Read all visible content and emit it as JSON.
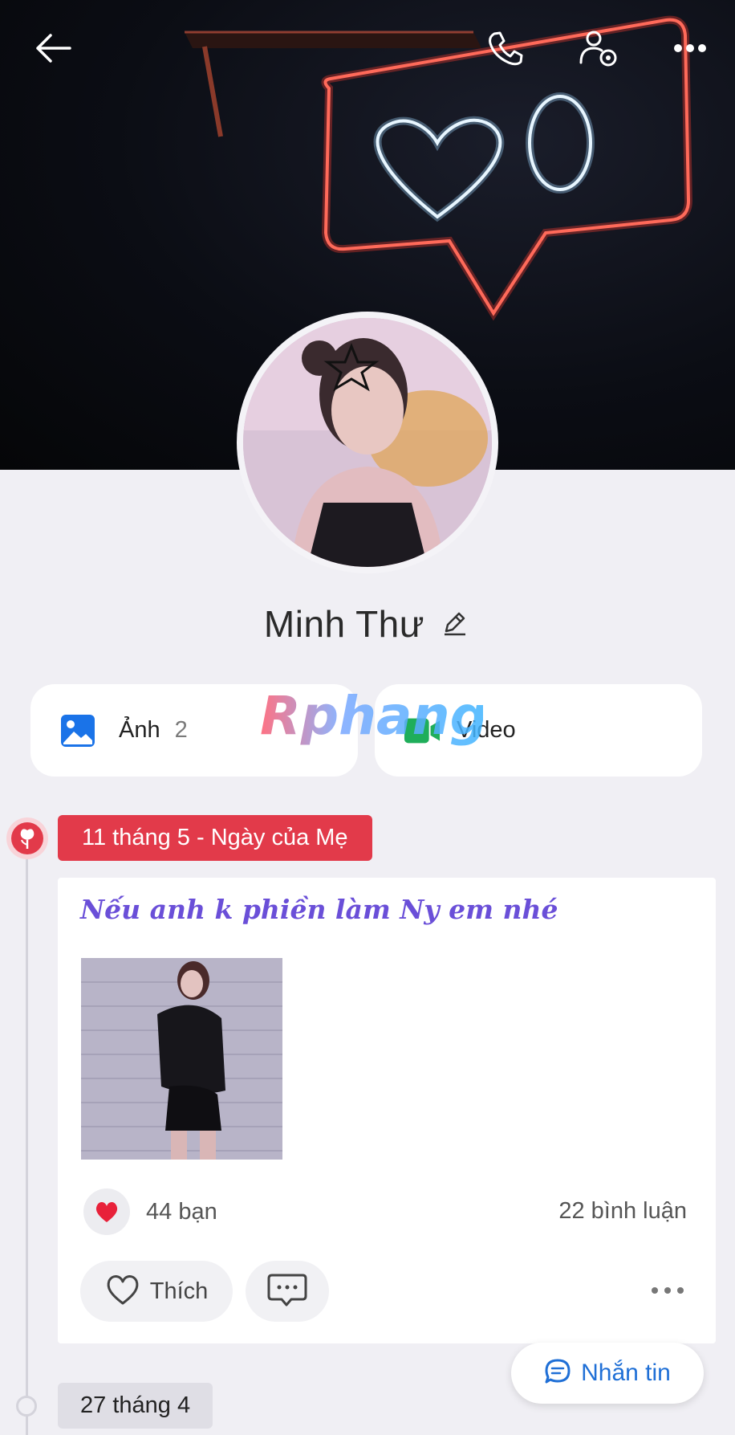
{
  "header": {
    "back_icon": "arrow-left-icon",
    "call_icon": "phone-icon",
    "settings_icon": "user-settings-icon",
    "more_icon": "more-horizontal-icon"
  },
  "profile": {
    "name": "Minh Thư",
    "edit_icon": "pencil-icon"
  },
  "media_tiles": {
    "photos": {
      "label": "Ảnh",
      "count": "2",
      "icon": "image-icon"
    },
    "videos": {
      "label": "Video",
      "icon": "video-icon"
    }
  },
  "watermark": "Rphang",
  "timeline": {
    "events": [
      {
        "label": "11 tháng 5 - Ngày của Mẹ",
        "icon": "flower-icon",
        "accent": "#e23a4a",
        "post": {
          "text": "Nếu anh k phiền làm Ny em nhé",
          "reactions": "44 bạn",
          "comments": "22 bình luận",
          "like_label": "Thích"
        }
      },
      {
        "label": "27 tháng 4"
      }
    ]
  },
  "chat_button": {
    "label": "Nhắn tin",
    "icon": "chat-bubble-icon"
  },
  "colors": {
    "accent_red": "#e23a4a",
    "link_blue": "#1f6fd6",
    "post_text": "#6a4fd8",
    "background": "#f0eff4"
  }
}
